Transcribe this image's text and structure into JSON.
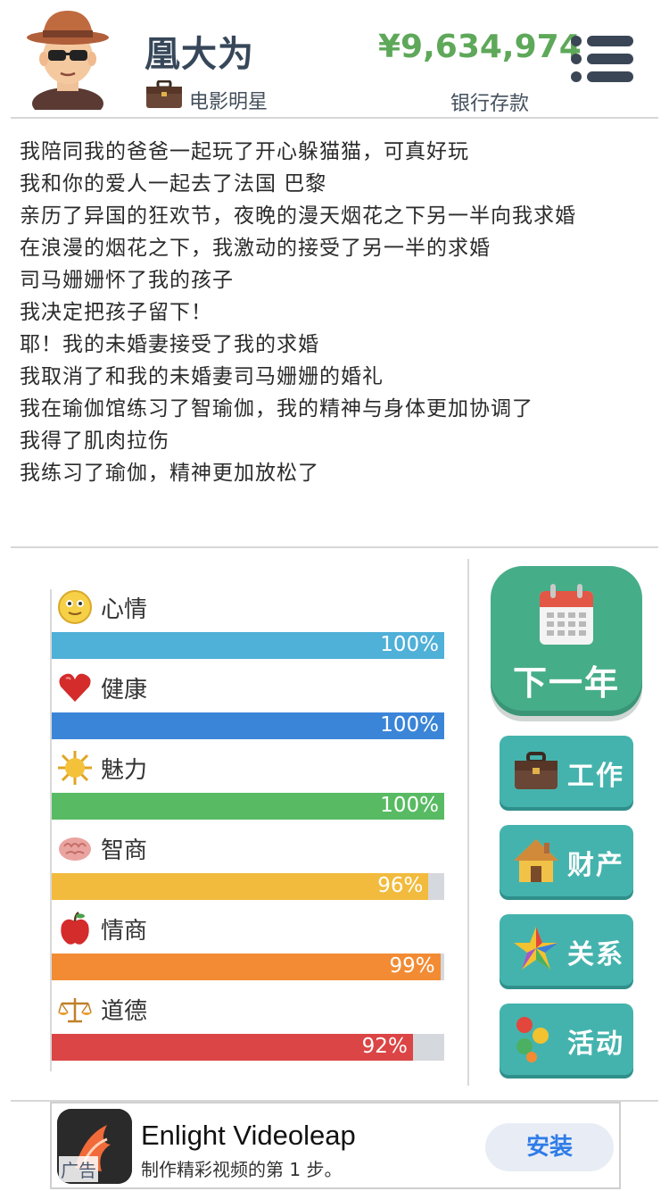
{
  "header": {
    "player_name": "凰大为",
    "job_title": "电影明星",
    "bank_amount": "¥9,634,974",
    "bank_label": "银行存款"
  },
  "event_log": {
    "events": [
      "我陪同我的爸爸一起玩了开心躲猫猫，可真好玩",
      "我和你的爱人一起去了法国 巴黎",
      "亲历了异国的狂欢节，夜晚的漫天烟花之下另一半向我求婚",
      "在浪漫的烟花之下，我激动的接受了另一半的求婚",
      "司马姗姗怀了我的孩子",
      "我决定把孩子留下！",
      "耶！我的未婚妻接受了我的求婚",
      "我取消了和我的未婚妻司马姗姗的婚礼",
      "我在瑜伽馆练习了智瑜伽，我的精神与身体更加协调了",
      "我得了肌肉拉伤",
      "我练习了瑜伽，精神更加放松了"
    ]
  },
  "stats": [
    {
      "label": "心情",
      "value_text": "100%",
      "percent": 100,
      "color": "#4fb0d8",
      "icon": "smiley-icon"
    },
    {
      "label": "健康",
      "value_text": "100%",
      "percent": 100,
      "color": "#3b85d8",
      "icon": "heart-icon"
    },
    {
      "label": "魅力",
      "value_text": "100%",
      "percent": 100,
      "color": "#58bb63",
      "icon": "sun-icon"
    },
    {
      "label": "智商",
      "value_text": "96%",
      "percent": 96,
      "color": "#f2bb3d",
      "icon": "brain-icon"
    },
    {
      "label": "情商",
      "value_text": "99%",
      "percent": 99,
      "color": "#f28b33",
      "icon": "apple-icon"
    },
    {
      "label": "道德",
      "value_text": "92%",
      "percent": 92,
      "color": "#dc4545",
      "icon": "scales-icon"
    }
  ],
  "actions": {
    "next_year_label": "下一年",
    "buttons": [
      {
        "label": "工作",
        "icon": "briefcase-icon"
      },
      {
        "label": "财产",
        "icon": "house-icon"
      },
      {
        "label": "关系",
        "icon": "star-icon"
      },
      {
        "label": "活动",
        "icon": "balls-icon"
      }
    ]
  },
  "ad": {
    "title": "Enlight Videoleap",
    "subtitle": "制作精彩视频的第 1 步。",
    "tag": "广告",
    "install_label": "安装"
  }
}
